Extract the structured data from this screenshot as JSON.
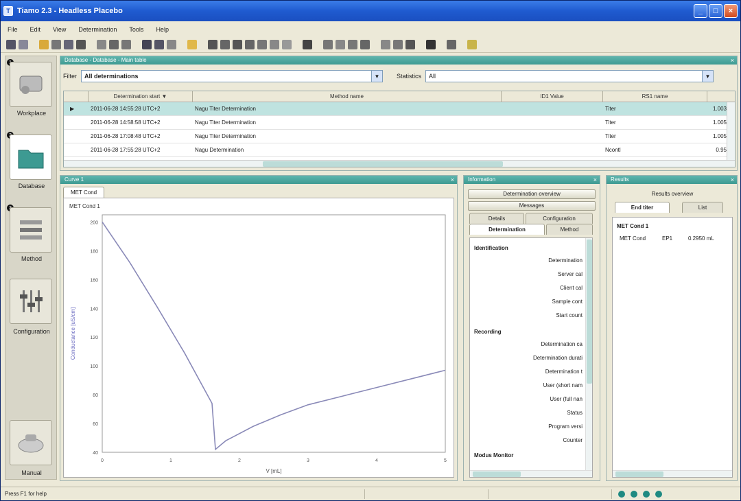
{
  "window": {
    "title": "Tiamo 2.3 - Headless Placebo"
  },
  "menu": [
    "File",
    "Edit",
    "View",
    "Determination",
    "Tools",
    "Help"
  ],
  "nav": {
    "items": [
      {
        "label": "Workplace",
        "num": "1"
      },
      {
        "label": "Database",
        "num": "2"
      },
      {
        "label": "Method",
        "num": "3"
      },
      {
        "label": "Configuration",
        "num": ""
      },
      {
        "label": "Manual",
        "num": ""
      }
    ]
  },
  "browser": {
    "title": "Database - Database - Main table",
    "filter_label": "Filter",
    "filter_value": "All determinations",
    "statistics_label": "Statistics",
    "statistics_value": "All",
    "columns": [
      "Determination start",
      "Method name",
      "ID1 Value",
      "RS1 name"
    ],
    "rows": [
      {
        "start": "2011-06-28 14:55:28 UTC+2",
        "method": "Nagu Titer Determination",
        "id1": "",
        "rs1": "Titer",
        "val": "1.003"
      },
      {
        "start": "2011-06-28 14:58:58 UTC+2",
        "method": "Nagu Titer Determination",
        "id1": "",
        "rs1": "Titer",
        "val": "1.005"
      },
      {
        "start": "2011-06-28 17:08:48 UTC+2",
        "method": "Nagu Titer Determination",
        "id1": "",
        "rs1": "Titer",
        "val": "1.005"
      },
      {
        "start": "2011-06-28 17:55:28 UTC+2",
        "method": "Nagu Determination",
        "id1": "",
        "rs1": "Ncontl",
        "val": "0.95"
      }
    ]
  },
  "graph": {
    "title": "Curve 1",
    "tabs": [
      "MET Cond"
    ]
  },
  "info": {
    "title": "Information",
    "buttons": [
      "Determination overview",
      "Messages"
    ],
    "subtabs_row1": [
      "Details",
      "Configuration"
    ],
    "subtabs_row2": [
      "Determination",
      "Method"
    ],
    "sections": [
      {
        "heading": "Identification",
        "items": [
          "Determination",
          "Server cal",
          "Client cal",
          "Sample cont",
          "Start count"
        ]
      },
      {
        "heading": "Recording",
        "items": [
          "Determination ca",
          "Determination durati",
          "Determination t",
          "User (short nam",
          "User (full nan",
          "Status",
          "Program versi",
          "Counter"
        ]
      },
      {
        "heading": "Modus Monitor",
        "items": []
      }
    ]
  },
  "results": {
    "title": "Results",
    "overview_label": "Results overview",
    "tabs": [
      "End titer",
      "List"
    ],
    "heading": "MET Cond 1",
    "row": {
      "name": "MET Cond",
      "ep": "EP1",
      "value": "0.2950 mL"
    }
  },
  "status": {
    "text": "Press F1 for help"
  },
  "chart_data": {
    "type": "line",
    "title": "MET Cond 1",
    "xlabel": "V [mL]",
    "ylabel": "Conductance [uS/cm]",
    "x_ticks": [
      "0",
      "1",
      "2",
      "3",
      "4",
      "5"
    ],
    "y_ticks": [
      "200",
      "180",
      "160",
      "140",
      "120",
      "100",
      "80",
      "60",
      "40"
    ],
    "xlim": [
      0,
      5
    ],
    "ylim": [
      40,
      205
    ],
    "series": [
      {
        "values_x": [
          0,
          0.4,
          0.8,
          1.2,
          1.6,
          1.65,
          1.8,
          2.2,
          2.6,
          3.0,
          3.5,
          4.0,
          4.5,
          5.0
        ],
        "values_y": [
          200,
          172,
          141,
          109,
          74,
          42,
          48,
          58,
          66,
          73,
          79,
          85,
          91,
          97
        ]
      }
    ]
  },
  "colors": {
    "teal": "#3d9a92",
    "titlebar": "#1f5bd0",
    "line": "#8a8ab8"
  }
}
